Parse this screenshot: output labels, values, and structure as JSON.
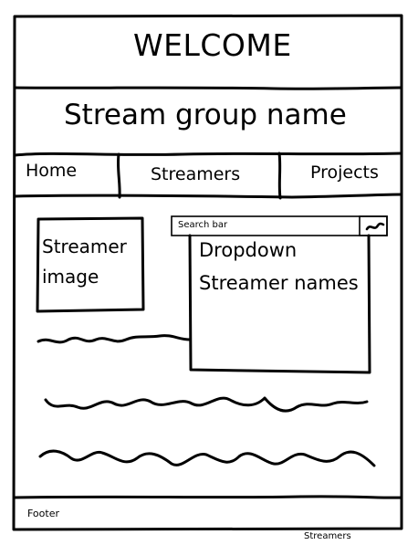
{
  "header": {
    "title": "WELCOME",
    "subtitle": "Stream group name"
  },
  "nav": {
    "home": "Home",
    "streamers": "Streamers",
    "projects": "Projects"
  },
  "main": {
    "streamer_image": {
      "line1": "Streamer",
      "line2": "image"
    },
    "search": {
      "placeholder": "Search bar"
    },
    "dropdown": {
      "line1": "Dropdown",
      "line2": "Streamer names"
    }
  },
  "footer": {
    "label": "Footer"
  },
  "page_caption": "Streamers",
  "icons": {
    "dropdown_toggle": "chevron-down-icon"
  }
}
